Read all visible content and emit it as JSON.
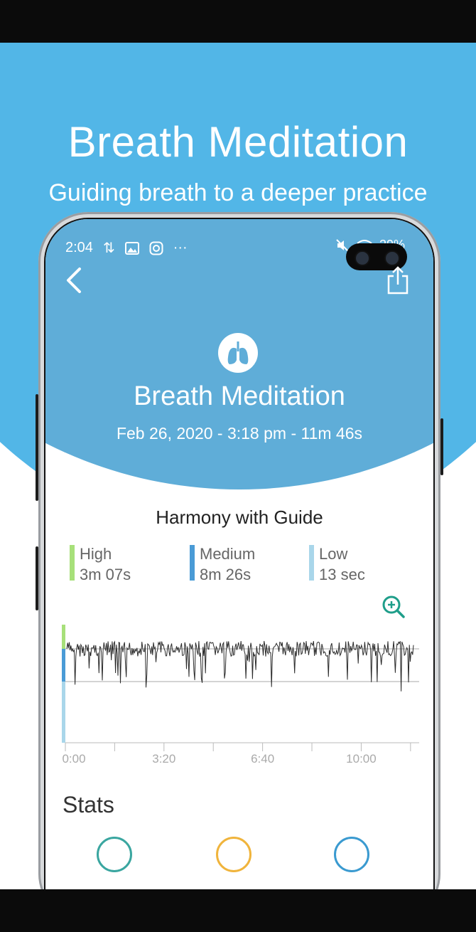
{
  "promo": {
    "title": "Breath Meditation",
    "subtitle": "Guiding breath to a deeper practice"
  },
  "status_bar": {
    "time": "2:04",
    "battery": "29%"
  },
  "header": {
    "title": "Breath Meditation",
    "session_info": "Feb 26, 2020 - 3:18 pm - 11m 46s",
    "icon": "lungs-icon"
  },
  "harmony": {
    "title": "Harmony with Guide",
    "levels": [
      {
        "label": "High",
        "value": "3m 07s",
        "color": "#a7e07a"
      },
      {
        "label": "Medium",
        "value": "8m 26s",
        "color": "#4a9bd6"
      },
      {
        "label": "Low",
        "value": "13 sec",
        "color": "#a9d6ea"
      }
    ]
  },
  "chart_data": {
    "type": "line",
    "x_ticks": [
      "0:00",
      "3:20",
      "6:40",
      "10:00"
    ],
    "x_range_seconds": [
      0,
      706
    ],
    "series": [
      {
        "values": []
      }
    ],
    "colors": {
      "high": "#a7e07a",
      "medium": "#4a9bd6",
      "low": "#a9d6ea",
      "line": "#2b2b2b"
    }
  },
  "stats": {
    "title": "Stats",
    "circle_colors": [
      "#3aa6a0",
      "#f0b43c",
      "#3a9ad0"
    ]
  }
}
